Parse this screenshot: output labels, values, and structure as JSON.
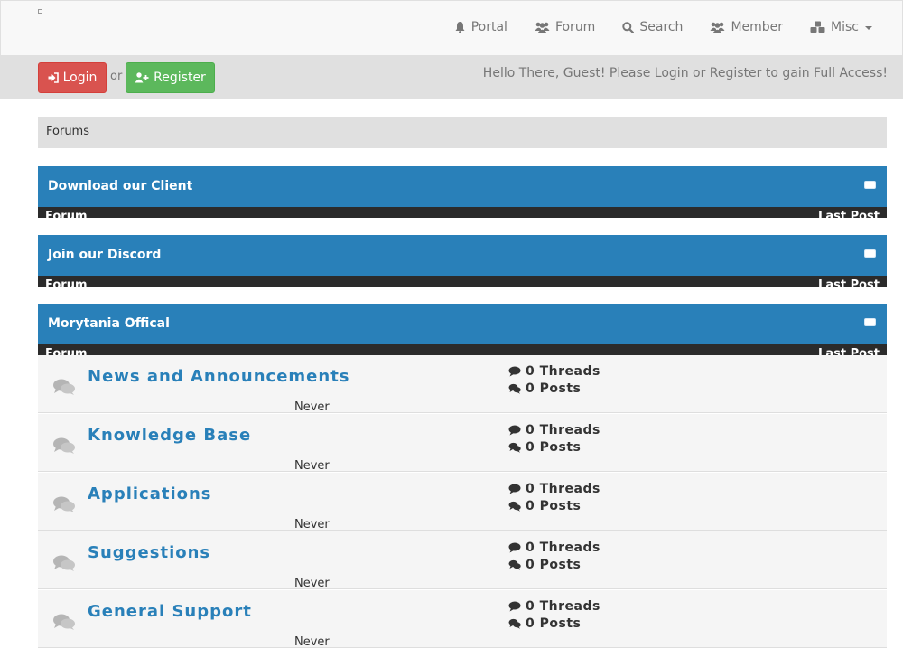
{
  "nav": {
    "items": [
      {
        "label": "Portal",
        "icon": "bell-icon"
      },
      {
        "label": "Forum",
        "icon": "users-icon"
      },
      {
        "label": "Search",
        "icon": "search-icon"
      },
      {
        "label": "Member",
        "icon": "users-icon"
      },
      {
        "label": "Misc",
        "icon": "cubes-icon"
      }
    ]
  },
  "userbar": {
    "login_label": "Login",
    "or_label": "or",
    "register_label": "Register",
    "welcome_text": "Hello There, Guest! Please Login or Register to gain Full Access!"
  },
  "breadcrumb": "Forums",
  "categories": [
    {
      "title": "Download our Client",
      "col_forum": "Forum",
      "col_lastpost": "Last Post"
    },
    {
      "title": "Join our Discord",
      "col_forum": "Forum",
      "col_lastpost": "Last Post"
    },
    {
      "title": "Morytania Offical",
      "col_forum": "Forum",
      "col_lastpost": "Last Post"
    }
  ],
  "forums": [
    {
      "title": "News and Announcements",
      "threads": "0 Threads",
      "posts": "0 Posts",
      "last_post": "Never"
    },
    {
      "title": "Knowledge Base",
      "threads": "0 Threads",
      "posts": "0 Posts",
      "last_post": "Never"
    },
    {
      "title": "Applications",
      "threads": "0 Threads",
      "posts": "0 Posts",
      "last_post": "Never"
    },
    {
      "title": "Suggestions",
      "threads": "0 Threads",
      "posts": "0 Posts",
      "last_post": "Never"
    },
    {
      "title": "General Support",
      "threads": "0 Threads",
      "posts": "0 Posts",
      "last_post": "Never"
    }
  ],
  "colors": {
    "accent": "#2980b9",
    "login": "#d9534f",
    "register": "#5cb85c",
    "subheader": "#2b2b2b"
  }
}
